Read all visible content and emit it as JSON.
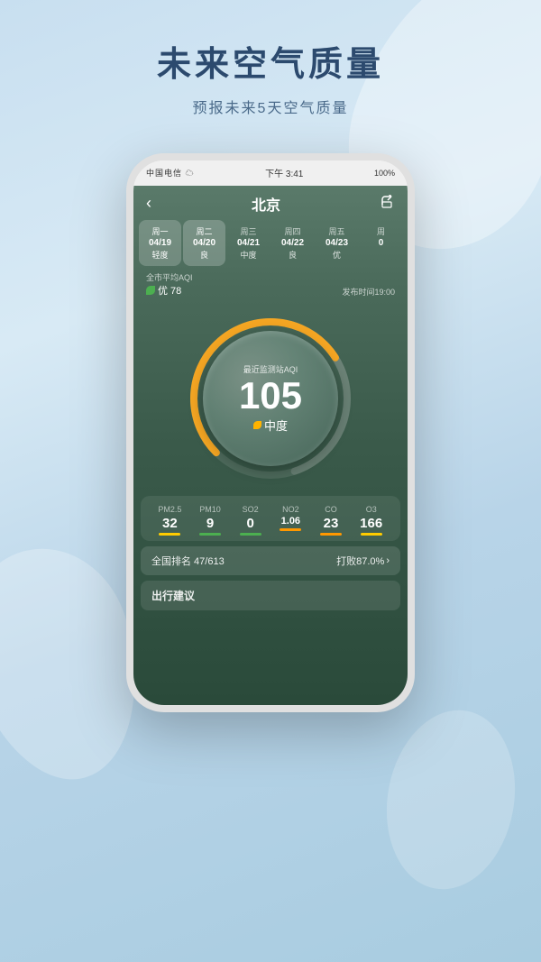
{
  "page": {
    "title": "未来空气质量",
    "subtitle": "预报未来5天空气质量"
  },
  "phone": {
    "status": {
      "carrier": "中国电信 ☁",
      "time": "下午 3:41",
      "battery": "100%"
    }
  },
  "app": {
    "back_label": "‹",
    "city": "北京",
    "share_icon": "⬆",
    "aqi_label": "全市平均AQI",
    "aqi_value": "优 78",
    "publish_time": "发布时间19:00",
    "gauge_label": "最近监测站AQI",
    "gauge_value": "105",
    "gauge_quality": "中度",
    "days": [
      {
        "week": "周一",
        "date": "04/19",
        "quality": "轻度",
        "active": false
      },
      {
        "week": "周二",
        "date": "04/20",
        "quality": "良",
        "active": true
      },
      {
        "week": "周三",
        "date": "04/21",
        "quality": "中度",
        "active": false
      },
      {
        "week": "周四",
        "date": "04/22",
        "quality": "良",
        "active": false
      },
      {
        "week": "周五",
        "date": "04/23",
        "quality": "优",
        "active": false
      },
      {
        "week": "周",
        "date": "0",
        "quality": "",
        "active": false
      }
    ],
    "pollutants": [
      {
        "name": "PM2.5",
        "value": "32",
        "color": "#ffcc00"
      },
      {
        "name": "PM10",
        "value": "9",
        "color": "#4caf50"
      },
      {
        "name": "SO2",
        "value": "0",
        "color": "#4caf50"
      },
      {
        "name": "NO2",
        "value": "1.06",
        "color": "#ff9800"
      },
      {
        "name": "CO",
        "value": "23",
        "color": "#ff9800"
      },
      {
        "name": "O3",
        "value": "166",
        "color": "#ffcc00"
      }
    ],
    "ranking": {
      "label": "全国排名 47/613",
      "right": "打败87.0%",
      "arrow": "›"
    },
    "advice_title": "出行建议"
  }
}
